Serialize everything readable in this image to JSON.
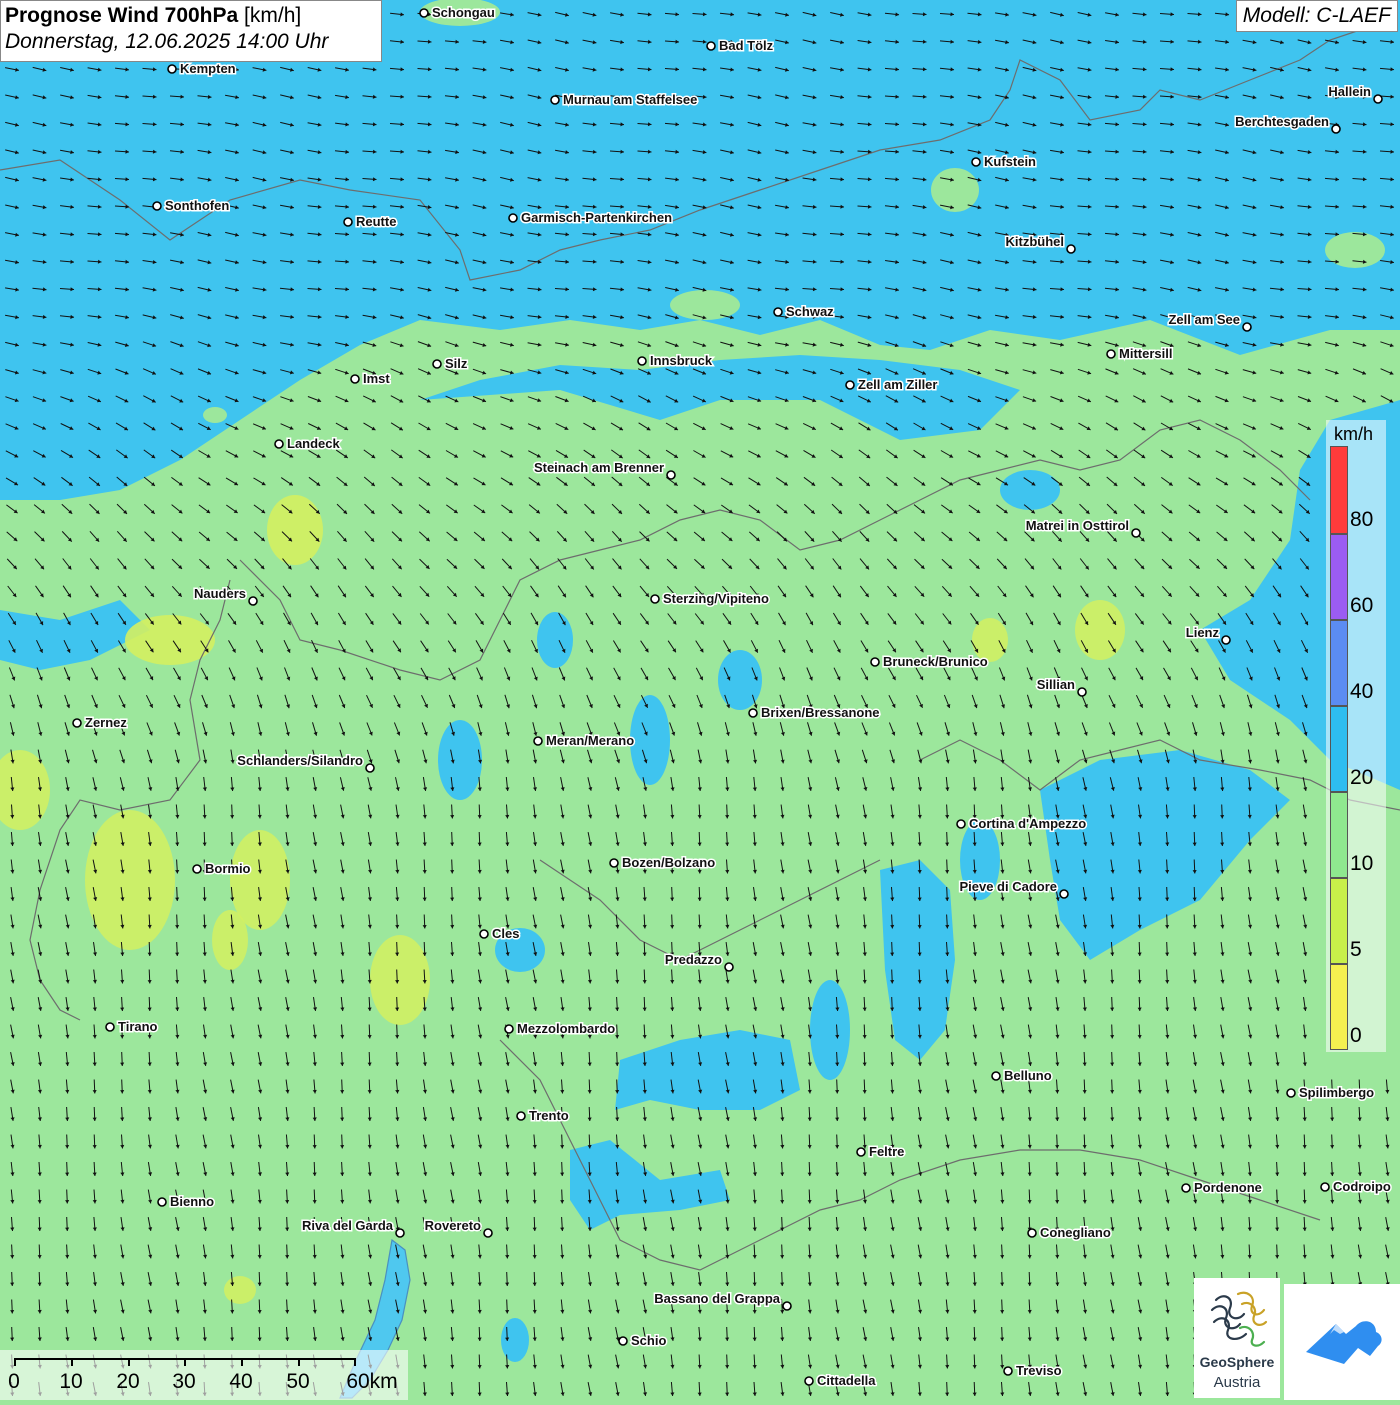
{
  "header": {
    "title_bold": "Prognose Wind 700hPa",
    "title_unit": "[km/h]",
    "datetime": "Donnerstag, 12.06.2025 14:00 Uhr",
    "model": "Modell: C-LAEF"
  },
  "legend": {
    "unit": "km/h",
    "segments": [
      {
        "label": "80",
        "color": "#ff3b3b"
      },
      {
        "label": "60",
        "color": "#9b5cf2"
      },
      {
        "label": "40",
        "color": "#5b8cf2"
      },
      {
        "label": "20",
        "color": "#2ebdf0"
      },
      {
        "label": "10",
        "color": "#8fe88f"
      },
      {
        "label": "5",
        "color": "#c8f04a"
      },
      {
        "label": "0",
        "color": "#f5f050"
      }
    ]
  },
  "scalebar": {
    "labels": [
      "0",
      "10",
      "20",
      "30",
      "40",
      "50",
      "60km"
    ]
  },
  "logos": {
    "geosphere_line1": "GeoSphere",
    "geosphere_line2": "Austria"
  },
  "cities": [
    {
      "name": "Schongau",
      "label_side": "right"
    },
    {
      "name": "Bad Tölz",
      "label_side": "right"
    },
    {
      "name": "Kempten",
      "label_side": "right"
    },
    {
      "name": "Murnau am Staffelsee",
      "label_side": "right"
    },
    {
      "name": "Hallein",
      "label_side": "left"
    },
    {
      "name": "Berchtesgaden",
      "label_side": "left"
    },
    {
      "name": "Kufstein",
      "label_side": "right"
    },
    {
      "name": "Sonthofen",
      "label_side": "right"
    },
    {
      "name": "Reutte",
      "label_side": "right"
    },
    {
      "name": "Garmisch-Partenkirchen",
      "label_side": "right"
    },
    {
      "name": "Kitzbühel",
      "label_side": "left"
    },
    {
      "name": "Schwaz",
      "label_side": "right"
    },
    {
      "name": "Zell am See",
      "label_side": "left"
    },
    {
      "name": "Innsbruck",
      "label_side": "right"
    },
    {
      "name": "Mittersill",
      "label_side": "right"
    },
    {
      "name": "Silz",
      "label_side": "right"
    },
    {
      "name": "Imst",
      "label_side": "right"
    },
    {
      "name": "Zell am Ziller",
      "label_side": "right"
    },
    {
      "name": "Landeck",
      "label_side": "right"
    },
    {
      "name": "Steinach am Brenner",
      "label_side": "left"
    },
    {
      "name": "Matrei in Osttirol",
      "label_side": "left"
    },
    {
      "name": "Nauders",
      "label_side": "left"
    },
    {
      "name": "Sterzing/Vipiteno",
      "label_side": "right"
    },
    {
      "name": "Lienz",
      "label_side": "left"
    },
    {
      "name": "Bruneck/Brunico",
      "label_side": "right"
    },
    {
      "name": "Sillian",
      "label_side": "left"
    },
    {
      "name": "Brixen/Bressanone",
      "label_side": "right"
    },
    {
      "name": "Zernez",
      "label_side": "right"
    },
    {
      "name": "Meran/Merano",
      "label_side": "right"
    },
    {
      "name": "Schlanders/Silandro",
      "label_side": "left"
    },
    {
      "name": "Cortina d'Ampezzo",
      "label_side": "right"
    },
    {
      "name": "Bozen/Bolzano",
      "label_side": "right"
    },
    {
      "name": "Bormio",
      "label_side": "right"
    },
    {
      "name": "Pieve di Cadore",
      "label_side": "left"
    },
    {
      "name": "Cles",
      "label_side": "right"
    },
    {
      "name": "Predazzo",
      "label_side": "left"
    },
    {
      "name": "Tirano",
      "label_side": "right"
    },
    {
      "name": "Mezzolombardo",
      "label_side": "right"
    },
    {
      "name": "Belluno",
      "label_side": "right"
    },
    {
      "name": "Spilimbergo",
      "label_side": "right"
    },
    {
      "name": "Trento",
      "label_side": "right"
    },
    {
      "name": "Feltre",
      "label_side": "right"
    },
    {
      "name": "Pordenone",
      "label_side": "right"
    },
    {
      "name": "Codroipo",
      "label_side": "right"
    },
    {
      "name": "Bienno",
      "label_side": "right"
    },
    {
      "name": "Riva del Garda",
      "label_side": "left"
    },
    {
      "name": "Rovereto",
      "label_side": "left"
    },
    {
      "name": "Conegliano",
      "label_side": "right"
    },
    {
      "name": "Bassano del Grappa",
      "label_side": "left"
    },
    {
      "name": "Schio",
      "label_side": "right"
    },
    {
      "name": "Treviso",
      "label_side": "right"
    },
    {
      "name": "Cittadella",
      "label_side": "right"
    }
  ]
}
